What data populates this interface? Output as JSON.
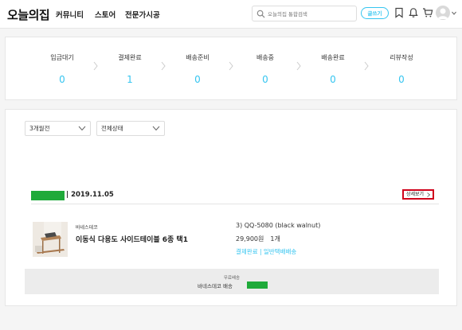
{
  "header": {
    "logo": "오늘의집",
    "nav": [
      "커뮤니티",
      "스토어",
      "전문가시공"
    ],
    "search_placeholder": "오늘의집 통합검색",
    "write_label": "글쓰기"
  },
  "status": [
    {
      "label": "입금대기",
      "count": "0"
    },
    {
      "label": "결제완료",
      "count": "1"
    },
    {
      "label": "배송준비",
      "count": "0"
    },
    {
      "label": "배송중",
      "count": "0"
    },
    {
      "label": "배송완료",
      "count": "0"
    },
    {
      "label": "리뷰작성",
      "count": "0"
    }
  ],
  "filters": {
    "period": "3개월전",
    "state": "전체상태"
  },
  "order": {
    "date": "| 2019.11.05",
    "detail_label": "상세보기",
    "brand": "바네스데코",
    "product_name": "이동식 다용도 사이드테이블 6종 택1",
    "option": "3) QQ-5080 (black walnut)",
    "price": "29,900원",
    "quantity": "1개",
    "status": "결제완료 | 일반택배배송",
    "shipping_type": "무료배송",
    "shipping_vendor": "바네스데코 배송"
  },
  "colors": {
    "accent": "#35c5f0",
    "redaction": "#1faa3a",
    "highlight": "#d0021b"
  }
}
